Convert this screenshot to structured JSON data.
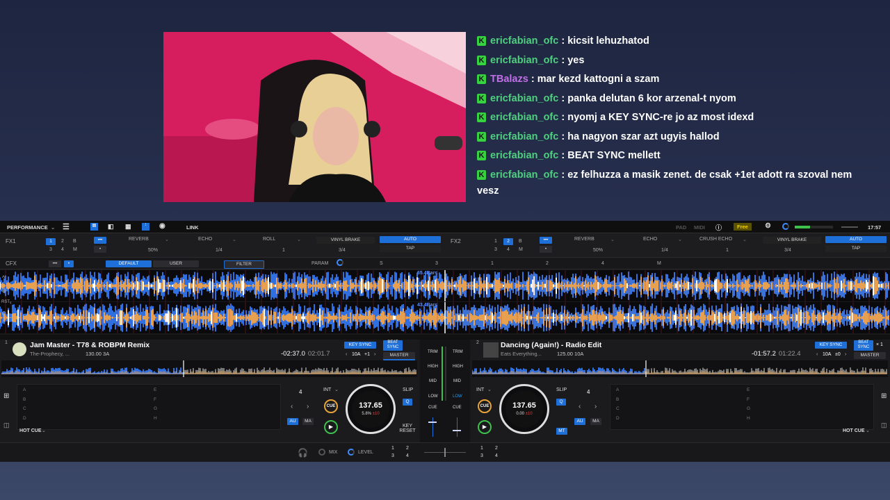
{
  "chat": [
    {
      "user": "ericfabian_ofc",
      "text": "kicsit lehuzhatod",
      "color": "#4fd07f"
    },
    {
      "user": "ericfabian_ofc",
      "text": "yes",
      "color": "#4fd07f"
    },
    {
      "user": "TBalazs",
      "text": "mar kezd kattogni a szam",
      "color": "#c26ee8"
    },
    {
      "user": "ericfabian_ofc",
      "text": "panka delutan 6 kor arzenal-t nyom",
      "color": "#4fd07f"
    },
    {
      "user": "ericfabian_ofc",
      "text": "nyomj a KEY SYNC-re jo az most idexd",
      "color": "#4fd07f"
    },
    {
      "user": "ericfabian_ofc",
      "text": "ha nagyon szar azt ugyis hallod",
      "color": "#4fd07f"
    },
    {
      "user": "ericfabian_ofc",
      "text": "BEAT SYNC mellett",
      "color": "#4fd07f"
    },
    {
      "user": "ericfabian_ofc",
      "text": "ez felhuzza a masik zenet. de csak +1et adott ra szoval nem vesz",
      "color": "#4fd07f"
    }
  ],
  "chat_separator": " : ",
  "chat_badge": "K",
  "topbar": {
    "mode": "PERFORMANCE",
    "link": "LINK",
    "pad": "PAD",
    "midi": "MIDI",
    "free": "Free",
    "clock": "17:57"
  },
  "fx1": {
    "label": "FX1",
    "beats": [
      "1",
      "2",
      "B",
      "3",
      "4",
      "M"
    ],
    "dots": "•••",
    "slots": [
      "REVERB",
      "ECHO",
      "ROLL"
    ],
    "params": [
      "50%",
      "1/4",
      "1"
    ],
    "brake": "VINYL BRAKE",
    "brake_val": "3/4",
    "auto": "AUTO",
    "tap": "TAP"
  },
  "fx2": {
    "label": "FX2",
    "beats": [
      "1",
      "2",
      "B",
      "3",
      "4",
      "M"
    ],
    "dots": "•••",
    "slots": [
      "REVERB",
      "ECHO",
      "CRUSH ECHO"
    ],
    "params": [
      "50%",
      "1/4",
      "1"
    ],
    "brake": "VINYL BRAKE",
    "brake_val": "3/4",
    "auto": "AUTO",
    "tap": "TAP"
  },
  "cfx": {
    "label": "CFX",
    "dots": "•••",
    "default": "DEFAULT",
    "user": "USER",
    "filter": "FILTER",
    "param": "PARAM",
    "s": "S",
    "v3": "3",
    "v1": "1",
    "v2": "2",
    "v4": "4",
    "m": "M"
  },
  "wave": {
    "bars1": "65.4Bars",
    "bars2": "43.4Bars",
    "rst": "RST"
  },
  "deck1": {
    "num": "1",
    "title": "Jam Master - T78 & ROBPM Remix",
    "artist": "The-Prophecy, ...",
    "bpm_key": "130.00  3A",
    "remain": "-02:37.0",
    "elapsed": "02:01.7",
    "key_sync": "KEY SYNC",
    "beat_sync": "BEAT SYNC",
    "key": "10A",
    "key_adj": "+1",
    "master": "MASTER",
    "bpm": "137.65",
    "pitch": "5.8%",
    "pitch_range": "±10",
    "int": "INT",
    "slip": "SLIP",
    "q": "Q",
    "cue": "CUE",
    "au": "AU",
    "ma": "MA",
    "key_reset": "KEY RESET",
    "beat_count": "4",
    "hotcue": "HOT CUE",
    "pads": [
      "A",
      "B",
      "C",
      "D",
      "E",
      "F",
      "G",
      "H"
    ],
    "accent": "#e8a33a"
  },
  "deck2": {
    "num": "2",
    "title": "Dancing (Again!) - Radio Edit",
    "artist": "Eats Everything...",
    "bpm_key": "125.00  10A",
    "remain": "-01:57.2",
    "elapsed": "01:22.4",
    "key_sync": "KEY SYNC",
    "beat_sync": "BEAT SYNC",
    "beat_x": "× 1",
    "key": "10A",
    "key_adj": "±0",
    "master": "MASTER",
    "bpm": "137.65",
    "pitch": "0.00",
    "pitch_range": "±10",
    "int": "INT",
    "slip": "SLIP",
    "q": "Q",
    "cue": "CUE",
    "au": "AU",
    "ma": "MA",
    "mt": "MT",
    "beat_count": "4",
    "hotcue": "HOT CUE",
    "pads": [
      "A",
      "B",
      "C",
      "D",
      "E",
      "F",
      "G",
      "H"
    ]
  },
  "mixer": {
    "trim": "TRIM",
    "high": "HIGH",
    "mid": "MID",
    "low": "LOW",
    "cue": "CUE"
  },
  "bottom": {
    "mix": "MIX",
    "level": "LEVEL",
    "n1": "1",
    "n2": "2",
    "n3": "3",
    "n4": "4"
  },
  "colors": {
    "accent_blue": "#1f6fd8",
    "wave_blue": "#2f6fe0",
    "wave_orange": "#e6a050",
    "kick_green": "#36d23f"
  }
}
